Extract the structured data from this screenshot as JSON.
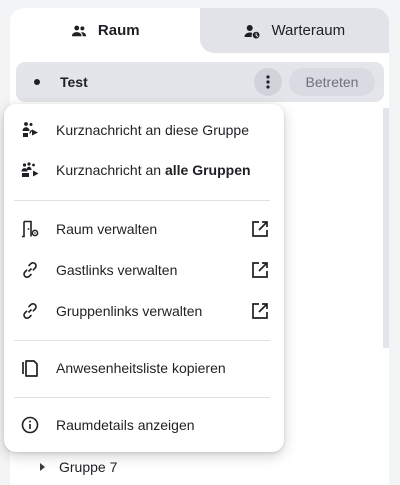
{
  "tabs": [
    {
      "label": "Raum",
      "icon": "group-icon",
      "active": true
    },
    {
      "label": "Warteraum",
      "icon": "clock-person-icon",
      "active": false
    }
  ],
  "room": {
    "name": "Test",
    "join_label": "Betreten"
  },
  "menu": {
    "items": [
      {
        "label": "Kurznachricht an diese Gruppe",
        "icon": "broadcast-group-icon"
      },
      {
        "label_prefix": "Kurznachricht an ",
        "label_bold": "alle Gruppen",
        "icon": "broadcast-all-groups-icon"
      },
      {
        "label": "Raum verwalten",
        "icon": "room-settings-icon",
        "external": true
      },
      {
        "label": "Gastlinks verwalten",
        "icon": "link-icon",
        "external": true
      },
      {
        "label": "Gruppenlinks verwalten",
        "icon": "link-icon",
        "external": true
      },
      {
        "label": "Anwesenheitsliste kopieren",
        "icon": "copy-icon"
      },
      {
        "label": "Raumdetails anzeigen",
        "icon": "info-icon"
      }
    ]
  },
  "groups": [
    {
      "label": "Gruppe 7"
    }
  ]
}
